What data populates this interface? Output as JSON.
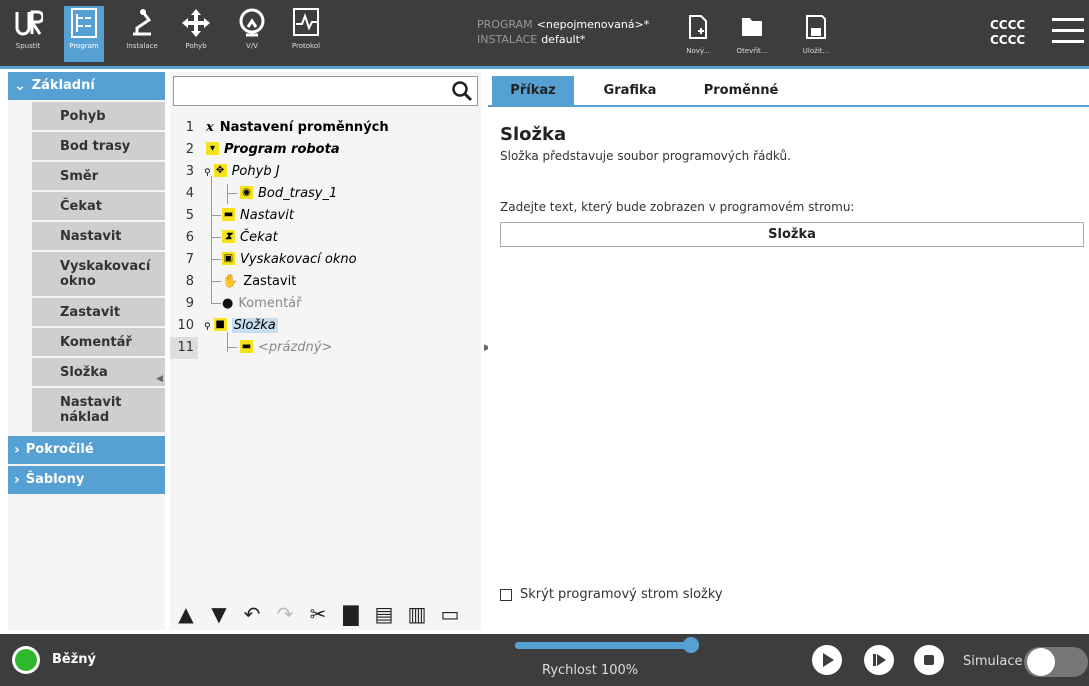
{
  "topbar": {
    "nav": [
      {
        "label": "Spustit",
        "icon": "ur-logo-icon"
      },
      {
        "label": "Program",
        "icon": "program-icon",
        "active": true
      },
      {
        "label": "Instalace",
        "icon": "installation-icon"
      },
      {
        "label": "Pohyb",
        "icon": "move-icon"
      },
      {
        "label": "V/V",
        "icon": "io-icon"
      },
      {
        "label": "Protokol",
        "icon": "log-icon"
      }
    ],
    "program_key": "PROGRAM",
    "program_value": "<nepojmenovaná>*",
    "installation_key": "INSTALACE",
    "installation_value": "default*",
    "file_buttons": [
      {
        "label": "Nový...",
        "icon": "new-file-icon"
      },
      {
        "label": "Otevřít...",
        "icon": "folder-icon"
      },
      {
        "label": "Uložit...",
        "icon": "save-icon"
      }
    ],
    "user_line1": "CCCC",
    "user_line2": "CCCC"
  },
  "left": {
    "basic_label": "Základní",
    "basic_items": [
      "Pohyb",
      "Bod trasy",
      "Směr",
      "Čekat",
      "Nastavit",
      "Vyskakovací okno",
      "Zastavit",
      "Komentář",
      "Složka",
      "Nastavit náklad"
    ],
    "advanced_label": "Pokročilé",
    "templates_label": "Šablony"
  },
  "tree": {
    "search_placeholder": "",
    "rows": [
      {
        "num": "1",
        "text": "Nastavení proměnných",
        "style": "bold",
        "icon": "variables-icon"
      },
      {
        "num": "2",
        "text": "Program robota",
        "style": "bolditalic",
        "icon": "program-node-icon"
      },
      {
        "num": "3",
        "text": "Pohyb J",
        "style": "italic",
        "icon": "move-node-icon"
      },
      {
        "num": "4",
        "text": "Bod_trasy_1",
        "style": "italic",
        "icon": "waypoint-icon"
      },
      {
        "num": "5",
        "text": "Nastavit",
        "style": "italic",
        "icon": "set-node-icon"
      },
      {
        "num": "6",
        "text": "Čekat",
        "style": "italic",
        "icon": "wait-node-icon"
      },
      {
        "num": "7",
        "text": "Vyskakovací okno",
        "style": "italic",
        "icon": "popup-node-icon"
      },
      {
        "num": "8",
        "text": "Zastavit",
        "style": "normal",
        "icon": "halt-node-icon"
      },
      {
        "num": "9",
        "text": "Komentář",
        "style": "gray",
        "icon": "comment-node-icon"
      },
      {
        "num": "10",
        "text": "Složka",
        "style": "selected",
        "icon": "folder-node-icon"
      },
      {
        "num": "11",
        "text": "<prázdný>",
        "style": "grayitalic",
        "icon": "empty-node-icon"
      }
    ]
  },
  "right": {
    "tabs": [
      "Příkaz",
      "Grafika",
      "Proměnné"
    ],
    "title": "Složka",
    "description": "Složka představuje soubor programových řádků.",
    "input_label": "Zadejte text, který bude zobrazen v programovém stromu:",
    "input_value": "Složka",
    "checkbox_label": "Skrýt programový strom složky"
  },
  "bottom": {
    "status": "Běžný",
    "speed_label": "Rychlost 100%",
    "speed_value": 1.0,
    "simulation_label": "Simulace"
  }
}
